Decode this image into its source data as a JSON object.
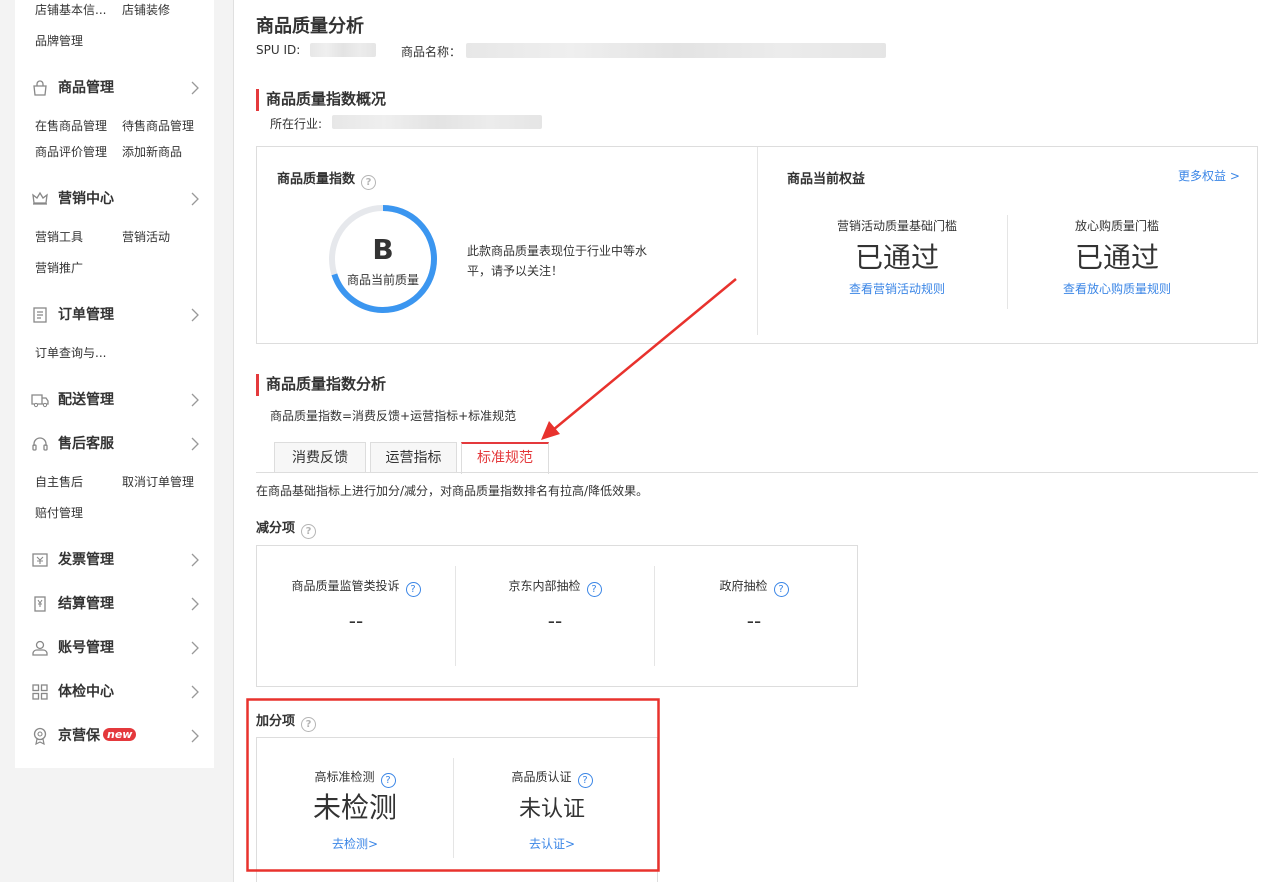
{
  "sidebar": {
    "top_row": [
      "店铺基本信...",
      "店铺装修"
    ],
    "top_row2": "品牌管理",
    "groups": [
      {
        "title": "商品管理",
        "icon": "bag-icon",
        "items": [
          [
            "在售商品管理",
            "待售商品管理"
          ],
          [
            "商品评价管理",
            "添加新商品"
          ]
        ]
      },
      {
        "title": "营销中心",
        "icon": "crown-icon",
        "items": [
          [
            "营销工具",
            "营销活动"
          ],
          [
            "营销推广"
          ]
        ]
      },
      {
        "title": "订单管理",
        "icon": "document-icon",
        "items": [
          [
            "订单查询与..."
          ]
        ]
      },
      {
        "title": "配送管理",
        "icon": "truck-icon",
        "items": []
      },
      {
        "title": "售后客服",
        "icon": "headset-icon",
        "items": [
          [
            "自主售后",
            "取消订单管理"
          ],
          [
            "赔付管理"
          ]
        ]
      },
      {
        "title": "发票管理",
        "icon": "invoice-icon",
        "items": []
      },
      {
        "title": "结算管理",
        "icon": "settlement-icon",
        "items": []
      },
      {
        "title": "账号管理",
        "icon": "user-icon",
        "items": []
      },
      {
        "title": "体检中心",
        "icon": "grid-icon",
        "items": []
      },
      {
        "title": "京营保",
        "icon": "badge-icon",
        "badge": "new",
        "items": []
      }
    ]
  },
  "header": {
    "title": "商品质量分析",
    "spu_label": "SPU ID:",
    "name_label": "商品名称："
  },
  "overview": {
    "title": "商品质量指数概况",
    "industry_label": "所在行业:",
    "index_title": "商品质量指数",
    "grade": "B",
    "grade_caption": "商品当前质量",
    "grade_progress": 0.7,
    "description": [
      "此款商品质量表现位于行业中等水",
      "平，请予以关注！"
    ],
    "rights_title": "商品当前权益",
    "more_rights": "更多权益 >",
    "rights": [
      {
        "label": "营销活动质量基础门槛",
        "status": "已通过",
        "link": "查看营销活动规则"
      },
      {
        "label": "放心购质量门槛",
        "status": "已通过",
        "link": "查看放心购质量规则"
      }
    ]
  },
  "analysis": {
    "title": "商品质量指数分析",
    "formula": "商品质量指数=消费反馈+运营指标+标准规范",
    "tabs": [
      "消费反馈",
      "运营指标",
      "标准规范"
    ],
    "active_tab": 2,
    "tab_description": "在商品基础指标上进行加分/减分，对商品质量指数排名有拉高/降低效果。",
    "deduction": {
      "title": "减分项",
      "items": [
        {
          "label": "商品质量监管类投诉",
          "value": "--"
        },
        {
          "label": "京东内部抽检",
          "value": "--"
        },
        {
          "label": "政府抽检",
          "value": "--"
        }
      ]
    },
    "bonus": {
      "title": "加分项",
      "items": [
        {
          "label": "高标准检测",
          "value": "未检测",
          "link": "去检测>"
        },
        {
          "label": "高品质认证",
          "value": "未认证",
          "link": "去认证>"
        }
      ]
    }
  },
  "colors": {
    "accent": "#e4393c",
    "link": "#3b86e6",
    "ring": "#3b96f0"
  }
}
